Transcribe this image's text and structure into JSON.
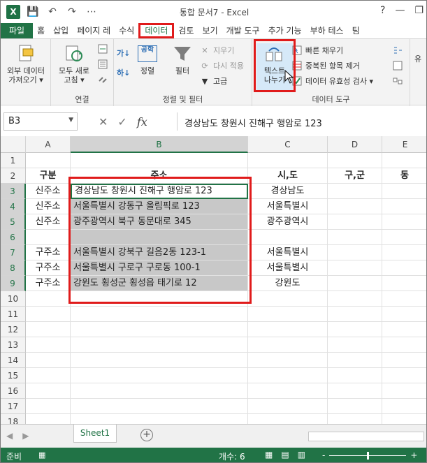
{
  "window": {
    "title": "통합 문서7 - Excel",
    "help": "?",
    "minimize": "—",
    "restore": "❐"
  },
  "qat": {
    "logo": "X",
    "save": "💾",
    "undo": "↶",
    "redo": "↷",
    "more": "⋯"
  },
  "tabs": [
    {
      "label": "파일"
    },
    {
      "label": "홈"
    },
    {
      "label": "삽입"
    },
    {
      "label": "페이지 레"
    },
    {
      "label": "수식"
    },
    {
      "label": "데이터"
    },
    {
      "label": "검토"
    },
    {
      "label": "보기"
    },
    {
      "label": "개발 도구"
    },
    {
      "label": "추가 기능"
    },
    {
      "label": "부하 테스"
    },
    {
      "label": "팀"
    }
  ],
  "ribbon": {
    "external": {
      "label1": "외부 데이터",
      "label2": "가져오기 ▾"
    },
    "refresh": {
      "label1": "모두 새로",
      "label2": "고침 ▾"
    },
    "connections_group": "연결",
    "sort_az": "가↓",
    "sort_za": "하↓",
    "sort": {
      "label": "정렬",
      "icon_text": "공학"
    },
    "filter": {
      "label": "필터"
    },
    "clear": "지우기",
    "reapply": "다시 적용",
    "advanced": "고급",
    "sort_filter_group": "정렬 및 필터",
    "text_to_columns": {
      "label1": "텍스트",
      "label2": "나누기"
    },
    "flash_fill": "빠른 채우기",
    "remove_duplicates": "중복된 항목 제거",
    "data_validation": "데이터 유효성 검사 ▾",
    "data_tools_group": "데이터 도구",
    "partial": "유"
  },
  "formula_bar": {
    "name_box": "B3",
    "cancel": "✕",
    "enter": "✓",
    "fx": "fx",
    "content": "경상남도 창원시 진해구 행암로 123"
  },
  "columns": [
    "A",
    "B",
    "C",
    "D",
    "E"
  ],
  "rows": [
    "1",
    "2",
    "3",
    "4",
    "5",
    "6",
    "7",
    "8",
    "9",
    "10",
    "11",
    "12",
    "13",
    "14",
    "15",
    "16",
    "17",
    "18"
  ],
  "cells": {
    "r2": {
      "a": "구분",
      "b": "주소",
      "c": "시,도",
      "d": "구,군",
      "e": "동"
    },
    "r3": {
      "a": "신주소",
      "b": "경상남도 창원시 진해구 행암로 123",
      "c": "경상남도"
    },
    "r4": {
      "a": "신주소",
      "b": "서울특별시 강동구 올림픽로 123",
      "c": "서울특별시"
    },
    "r5": {
      "a": "신주소",
      "b": "광주광역시 북구 동문대로 345",
      "c": "광주광역시"
    },
    "r7": {
      "a": "구주소",
      "b": "서울특별시 강북구 길음2동 123-1",
      "c": "서울특별시"
    },
    "r8": {
      "a": "구주소",
      "b": "서울특별시 구로구 구로동 100-1",
      "c": "서울특별시"
    },
    "r9": {
      "a": "구주소",
      "b": "강원도 횡성군 횡성읍 태기로 12",
      "c": "강원도"
    }
  },
  "sheets": [
    {
      "label": "Sheet1"
    }
  ],
  "add_sheet": "+",
  "status": {
    "ready": "준비",
    "count": "개수: 6",
    "zoom_minus": "-",
    "zoom_plus": "+"
  },
  "colors": {
    "accent": "#217346",
    "highlight": "#e01b1b"
  }
}
